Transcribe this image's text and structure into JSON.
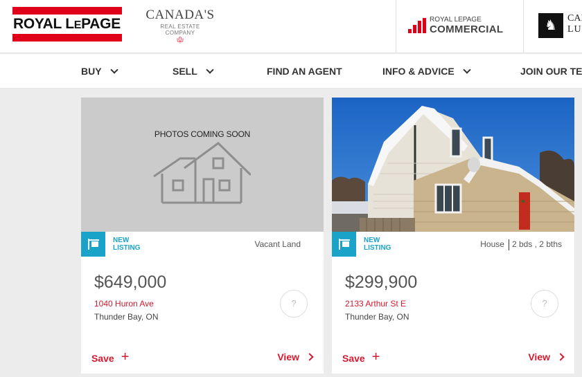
{
  "header": {
    "logo_main": "ROYAL LEPAGE",
    "logo_main_a": "ROYAL L",
    "logo_main_b": "E",
    "logo_main_c": "PAGE",
    "tagline_big": "CANADA'S",
    "tagline_small": "REAL ESTATE COMPANY",
    "commercial_line1": "ROYAL LEPAGE",
    "commercial_line2": "COMMERCIAL",
    "lux_line1": "CAR",
    "lux_line2": "LUX"
  },
  "nav": {
    "items": [
      {
        "label": "BUY"
      },
      {
        "label": "SELL"
      },
      {
        "label": "FIND AN AGENT"
      },
      {
        "label": "INFO & ADVICE"
      },
      {
        "label": "JOIN OUR TEA"
      }
    ]
  },
  "listings": [
    {
      "photo_text": "PHOTOS COMING SOON",
      "badge": "NEW LISTING",
      "badge_line1": "NEW",
      "badge_line2": "LISTING",
      "type": "Vacant Land",
      "price": "$649,000",
      "address": "1040 Huron Ave",
      "city": "Thunder Bay, ON",
      "save_label": "Save",
      "view_label": "View",
      "help": "?"
    },
    {
      "badge": "NEW LISTING",
      "badge_line1": "NEW",
      "badge_line2": "LISTING",
      "type": "House",
      "details": "2 bds , 2 bths",
      "price": "$299,900",
      "address": "2133 Arthur St E",
      "city": "Thunder Bay, ON",
      "save_label": "Save",
      "view_label": "View",
      "help": "?"
    }
  ],
  "colors": {
    "brand_red": "#e1001a",
    "link_red": "#d11a2f",
    "accent_blue": "#1aa3c8"
  }
}
